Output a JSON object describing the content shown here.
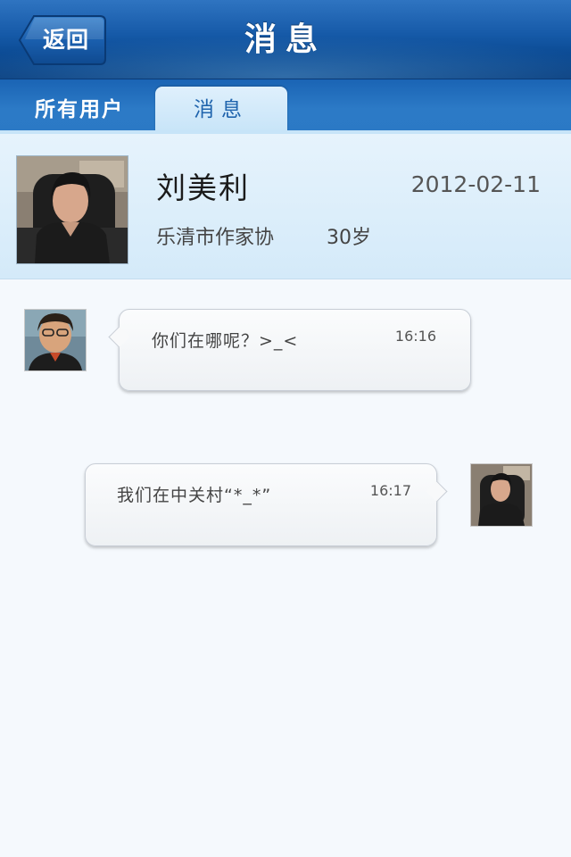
{
  "header": {
    "back_label": "返回",
    "title": "消息"
  },
  "tabs": [
    {
      "label": "所有用户",
      "active": false
    },
    {
      "label": "消息",
      "active": true
    }
  ],
  "profile": {
    "name": "刘美利",
    "date": "2012-02-11",
    "organization": "乐清市作家协",
    "age": "30岁"
  },
  "messages": [
    {
      "side": "left",
      "text": "你们在哪呢？>_<",
      "time": "16:16"
    },
    {
      "side": "right",
      "text": "我们在中关村“*_*”",
      "time": "16:17"
    }
  ],
  "colors": {
    "nav_blue": "#0b4a93",
    "tab_active_bg": "#c7e4f8",
    "tab_active_text": "#1f64ad",
    "profile_bg": "#d4eaf9",
    "page_bg": "#f5f9fd"
  }
}
